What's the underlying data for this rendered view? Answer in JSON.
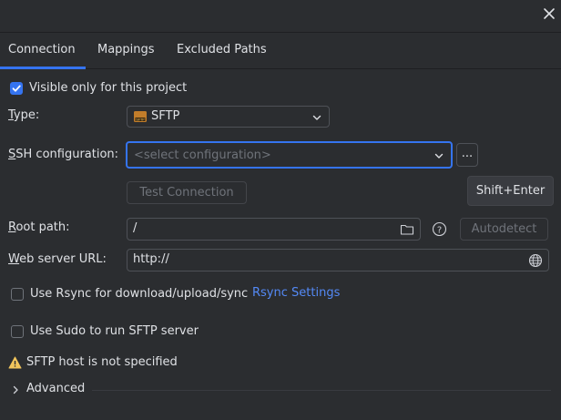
{
  "tabs": [
    {
      "label": "Connection",
      "active": true
    },
    {
      "label": "Mappings",
      "active": false
    },
    {
      "label": "Excluded Paths",
      "active": false
    }
  ],
  "visible_only": {
    "label": "Visible only for this project",
    "checked": true
  },
  "type": {
    "label_prefix": "",
    "label_mnemonic": "T",
    "label_rest": "ype:",
    "value": "SFTP",
    "icon": "sftp-icon"
  },
  "ssh": {
    "label_mnemonic": "S",
    "label_rest": "SH configuration:",
    "placeholder": "<select configuration>",
    "browse_label": "..."
  },
  "test_connection": {
    "label": "Test Connection"
  },
  "tooltip": {
    "text": "Shift+Enter"
  },
  "root_path": {
    "label_mnemonic": "R",
    "label_rest": "oot path:",
    "value": "/",
    "autodetect_label": "Autodetect"
  },
  "web_server": {
    "label_mnemonic": "W",
    "label_rest": "eb server URL:",
    "value": "http://"
  },
  "rsync": {
    "label": "Use Rsync for download/upload/sync",
    "checked": false,
    "settings_link": "Rsync Settings"
  },
  "sudo": {
    "label": "Use Sudo to run SFTP server",
    "checked": false
  },
  "warning": {
    "text": "SFTP host is not specified"
  },
  "advanced": {
    "label": "Advanced"
  },
  "colors": {
    "accent": "#3574f0",
    "link": "#548af7",
    "warning": "#f2c55c",
    "background": "#2b2d30"
  }
}
